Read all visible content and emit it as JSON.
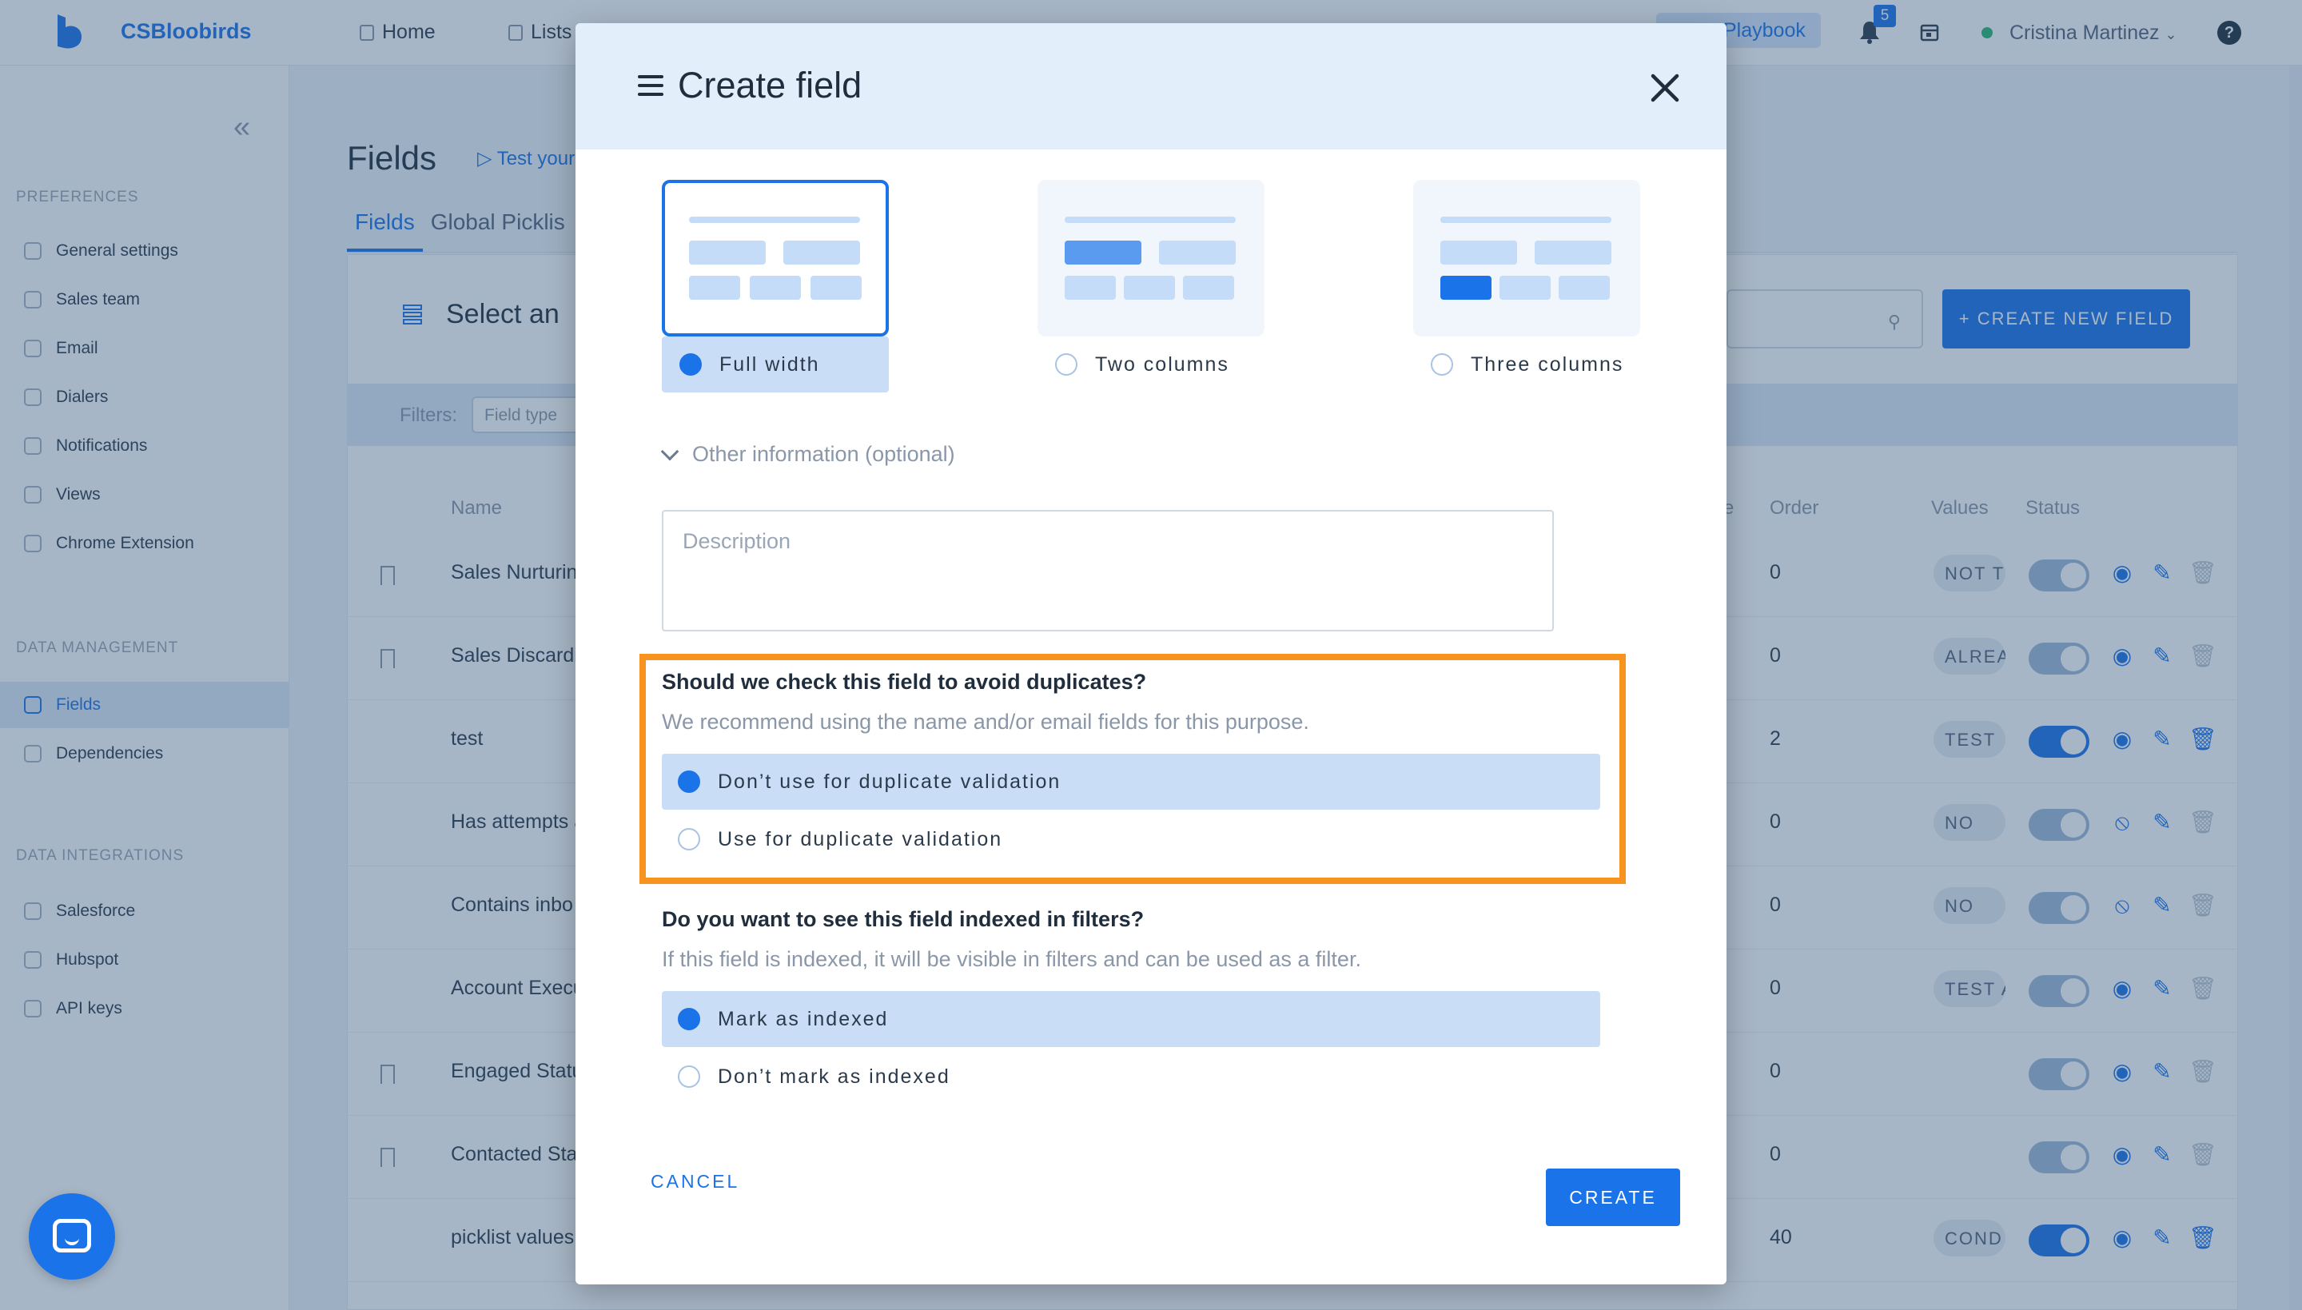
{
  "topbar": {
    "brand": "CSBloobirds",
    "nav": [
      {
        "label": "Home",
        "icon": "home-icon"
      },
      {
        "label": "Lists",
        "icon": "list-icon"
      }
    ],
    "playbook_label": "Playbook",
    "notifications_count": "5",
    "user_name": "Cristina Martinez",
    "help_label": "?"
  },
  "sidebar": {
    "sections": [
      {
        "title": "PREFERENCES",
        "items": [
          {
            "label": "General settings",
            "icon": "gear-icon"
          },
          {
            "label": "Sales team",
            "icon": "user-icon"
          },
          {
            "label": "Email",
            "icon": "mail-icon"
          },
          {
            "label": "Dialers",
            "icon": "phone-icon"
          },
          {
            "label": "Notifications",
            "icon": "bell-icon"
          },
          {
            "label": "Views",
            "icon": "file-icon"
          },
          {
            "label": "Chrome Extension",
            "icon": "chrome-icon"
          }
        ]
      },
      {
        "title": "DATA MANAGEMENT",
        "items": [
          {
            "label": "Fields",
            "icon": "fields-icon",
            "active": true
          },
          {
            "label": "Dependencies",
            "icon": "eye-icon"
          }
        ]
      },
      {
        "title": "DATA INTEGRATIONS",
        "items": [
          {
            "label": "Salesforce",
            "icon": "cloud-icon"
          },
          {
            "label": "Hubspot",
            "icon": "hubspot-icon"
          },
          {
            "label": "API keys",
            "icon": "key-icon"
          }
        ]
      }
    ]
  },
  "page": {
    "title": "Fields",
    "test_link": "Test your",
    "tabs": [
      "Fields",
      "Global Picklis"
    ],
    "select_text": "Select an",
    "create_new_label": "+ CREATE NEW FIELD",
    "filters_label": "Filters:",
    "field_type_placeholder": "Field type",
    "columns": {
      "name": "Name",
      "order_partial": "e",
      "order": "Order",
      "values": "Values",
      "status": "Status"
    },
    "rows": [
      {
        "name": "Sales Nurturin",
        "order": "0",
        "value": "NOT T",
        "bookmark": true,
        "toggle_on": false,
        "eye": "eye-icon",
        "trash_active": false
      },
      {
        "name": "Sales Discardi",
        "order": "0",
        "value": "ALREA",
        "bookmark": true,
        "toggle_on": false,
        "eye": "eye-icon",
        "trash_active": false
      },
      {
        "name": "test",
        "order": "2",
        "value": "TEST",
        "bookmark": false,
        "toggle_on": true,
        "eye": "eye-icon",
        "trash_active": true
      },
      {
        "name": "Has attempts a",
        "order": "0",
        "value": "NO",
        "bookmark": false,
        "toggle_on": false,
        "eye": "eye-off-icon",
        "trash_active": false
      },
      {
        "name": "Contains inbo",
        "order": "0",
        "value": "NO",
        "bookmark": false,
        "toggle_on": false,
        "eye": "eye-off-icon",
        "trash_active": false
      },
      {
        "name": "Account Execu",
        "order": "0",
        "value": "TEST A",
        "bookmark": false,
        "toggle_on": false,
        "eye": "eye-icon",
        "trash_active": false
      },
      {
        "name": "Engaged Statu",
        "order": "0",
        "value": "",
        "bookmark": true,
        "toggle_on": false,
        "eye": "eye-icon",
        "trash_active": false
      },
      {
        "name": "Contacted Sta",
        "order": "0",
        "value": "",
        "bookmark": true,
        "toggle_on": false,
        "eye": "eye-icon",
        "trash_active": false
      },
      {
        "name": "picklist values",
        "order": "40",
        "value": "COND",
        "bookmark": false,
        "toggle_on": true,
        "eye": "eye-icon",
        "trash_active": true
      }
    ]
  },
  "modal": {
    "title": "Create field",
    "layout_options": [
      {
        "label": "Full width",
        "selected": true
      },
      {
        "label": "Two columns",
        "selected": false
      },
      {
        "label": "Three columns",
        "selected": false
      }
    ],
    "other_info_label": "Other information (optional)",
    "description_placeholder": "Description",
    "duplicates": {
      "question": "Should we check this field to avoid duplicates?",
      "hint": "We recommend using the name and/or email fields for this purpose.",
      "options": [
        {
          "label": "Don’t use for duplicate validation",
          "selected": true
        },
        {
          "label": "Use for duplicate validation",
          "selected": false
        }
      ]
    },
    "indexed": {
      "question": "Do you want to see this field indexed in filters?",
      "hint": "If this field is indexed, it will be visible in filters and can be used as a filter.",
      "options": [
        {
          "label": "Mark as indexed",
          "selected": true
        },
        {
          "label": "Don’t mark as indexed",
          "selected": false
        }
      ]
    },
    "cancel_label": "CANCEL",
    "create_label": "CREATE"
  },
  "colors": {
    "accent": "#1a73e8",
    "highlight_border": "#f7931e",
    "selected_option_bg": "#c9ddf7",
    "header_bg": "#e3eefb"
  }
}
